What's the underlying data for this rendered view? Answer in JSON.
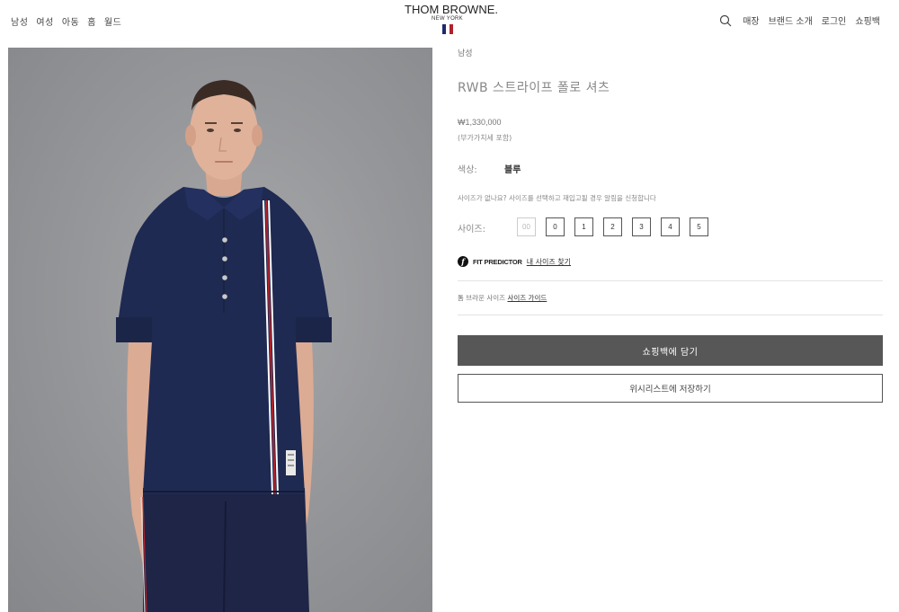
{
  "header": {
    "nav_left": [
      "남성",
      "여성",
      "아동",
      "홈",
      "월드"
    ],
    "logo": {
      "main": "THOM BROWNE.",
      "sub": "NEW YORK"
    },
    "nav_right": [
      "매장",
      "브랜드 소개",
      "로그인",
      "쇼핑백"
    ],
    "search_icon": "search-icon"
  },
  "product": {
    "category": "남성",
    "title": "RWB 스트라이프 폴로 셔츠",
    "price": "₩1,330,000",
    "vat": "(부가가치세 포함)",
    "color_label": "색상:",
    "color_value": "블루",
    "size_notice": "사이즈가 없나요? 사이즈를 선택하고 재입고될 경우 알림을 신청합니다",
    "size_label": "사이즈:",
    "sizes": [
      {
        "label": "00",
        "available": false
      },
      {
        "label": "0",
        "available": true
      },
      {
        "label": "1",
        "available": true
      },
      {
        "label": "2",
        "available": true
      },
      {
        "label": "3",
        "available": true
      },
      {
        "label": "4",
        "available": true
      },
      {
        "label": "5",
        "available": true
      }
    ],
    "fit_predictor": {
      "logo": "f",
      "text": "FIT PREDICTOR",
      "link": "내 사이즈 찾기"
    },
    "size_guide": {
      "text": "톰 브라운 사이즈",
      "link": "사이즈 가이드"
    },
    "add_to_bag": "쇼핑백에 담기",
    "wishlist": "위시리스트에 저장하기"
  },
  "colors": {
    "flag_blue": "#1f2a6b",
    "flag_white": "#ffffff",
    "flag_red": "#b3222b",
    "cart_button": "#575757",
    "shirt_navy": "#1f2a52"
  }
}
